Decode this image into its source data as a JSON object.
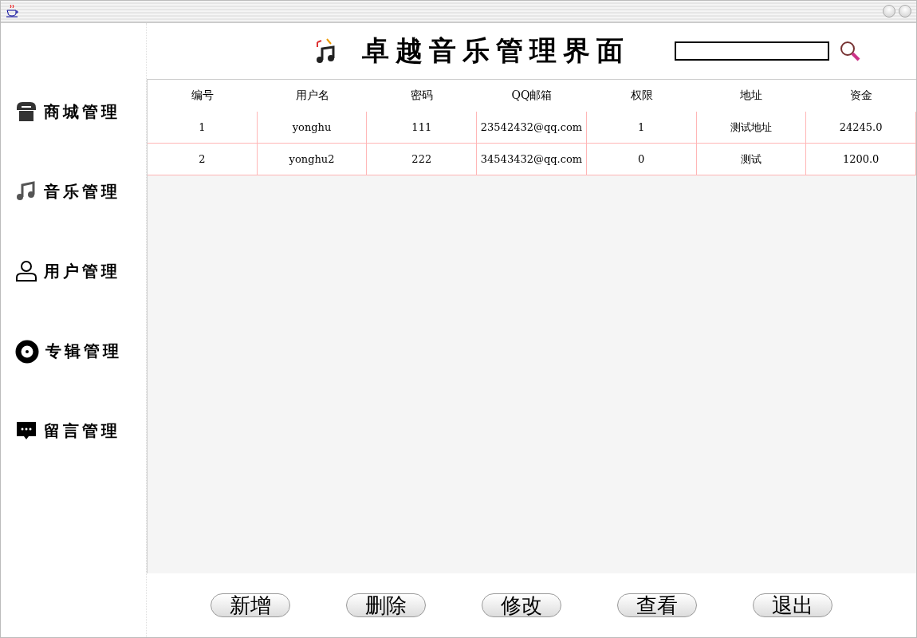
{
  "header": {
    "title": "卓越音乐管理界面"
  },
  "sidebar": {
    "items": [
      {
        "label": "商城管理",
        "kind": "store"
      },
      {
        "label": "音乐管理",
        "kind": "music"
      },
      {
        "label": "用户管理",
        "kind": "user"
      },
      {
        "label": "专辑管理",
        "kind": "album"
      },
      {
        "label": "留言管理",
        "kind": "message"
      }
    ]
  },
  "table": {
    "columns": [
      "编号",
      "用户名",
      "密码",
      "QQ邮箱",
      "权限",
      "地址",
      "资金"
    ],
    "rows": [
      [
        "1",
        "yonghu",
        "111",
        "23542432@qq.com",
        "1",
        "测试地址",
        "24245.0"
      ],
      [
        "2",
        "yonghu2",
        "222",
        "34543432@qq.com",
        "0",
        "测试",
        "1200.0"
      ]
    ]
  },
  "buttons": [
    "新增",
    "删除",
    "修改",
    "查看",
    "退出"
  ]
}
